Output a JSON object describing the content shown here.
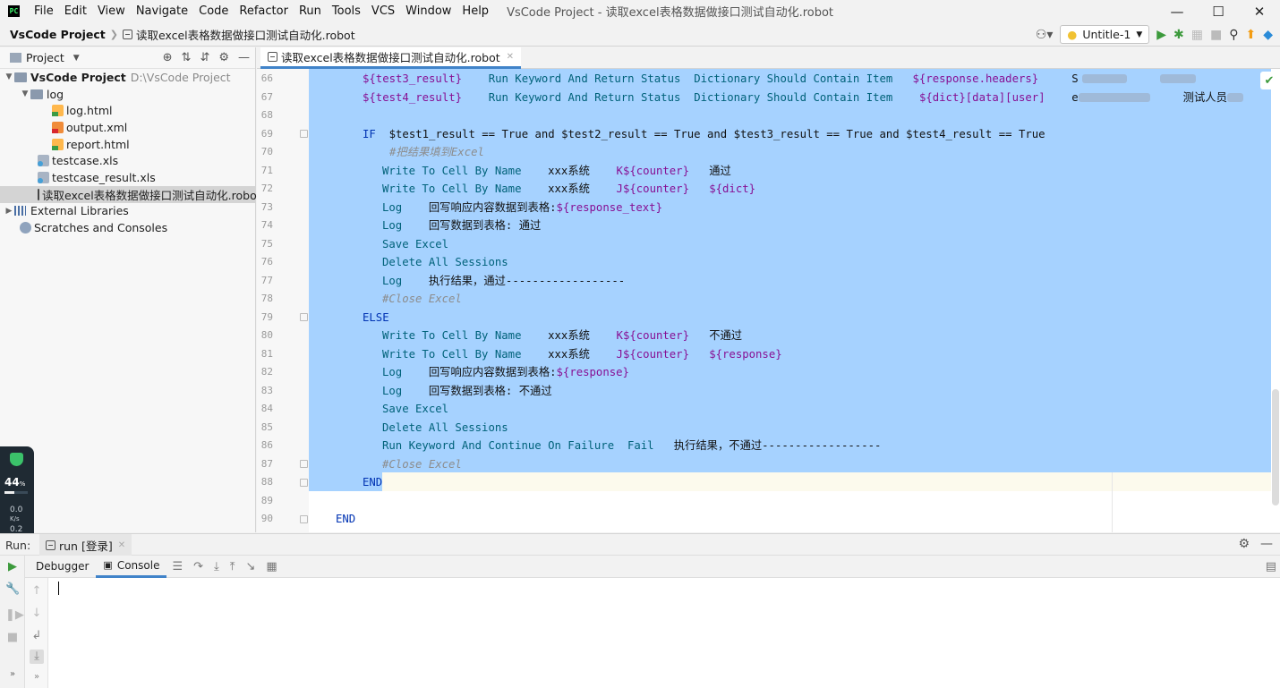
{
  "menubar": {
    "items": [
      "File",
      "Edit",
      "View",
      "Navigate",
      "Code",
      "Refactor",
      "Run",
      "Tools",
      "VCS",
      "Window",
      "Help"
    ],
    "window_title": "VsCode Project - 读取excel表格数据做接口测试自动化.robot"
  },
  "navbar": {
    "project": "VsCode Project",
    "file": "读取excel表格数据做接口测试自动化.robot",
    "run_config": "Untitle-1"
  },
  "project_panel": {
    "title": "Project",
    "root_name": "VsCode Project",
    "root_path": "D:\\VsCode Project",
    "folder_log": "log",
    "files": {
      "log_html": "log.html",
      "output_xml": "output.xml",
      "report_html": "report.html",
      "testcase": "testcase.xls",
      "testcase_result": "testcase_result.xls",
      "robot": "读取excel表格数据做接口测试自动化.robot"
    },
    "external_libraries": "External Libraries",
    "scratches": "Scratches and Consoles"
  },
  "editor": {
    "tab": "读取excel表格数据做接口测试自动化.robot",
    "line_numbers": [
      "66",
      "67",
      "68",
      "69",
      "70",
      "71",
      "72",
      "73",
      "74",
      "75",
      "76",
      "77",
      "78",
      "79",
      "80",
      "81",
      "82",
      "83",
      "84",
      "85",
      "86",
      "87",
      "88",
      "89",
      "90"
    ],
    "code": {
      "l66_var": "${test3_result}",
      "l66_kw": "Run Keyword And Return Status",
      "l66_kw2": "Dictionary Should Contain Item",
      "l66_arg": "${response.headers}",
      "l66_tail": "S",
      "l67_var": "${test4_result}",
      "l67_kw": "Run Keyword And Return Status",
      "l67_kw2": "Dictionary Should Contain Item",
      "l67_arg": "${dict}[data][user]",
      "l67_tail": "e",
      "l67_tail2": "测试人员",
      "l69_if": "IF",
      "l69_cond": "$test1_result == True and $test2_result == True and $test3_result == True and $test4_result == True",
      "l70_comment": "#把结果填到Excel",
      "write_kw": "Write To Cell By Name",
      "sys_name": "xxx系统",
      "k_counter": "K${counter}",
      "j_counter": "J${counter}",
      "pass": "通过",
      "dict_var": "${dict}",
      "log_kw": "Log",
      "l73_text": "回写响应内容数据到表格:",
      "l73_var": "${response_text}",
      "l74_text": "回写数据到表格: 通过",
      "save_kw": "Save Excel",
      "delete_kw": "Delete All Sessions",
      "l77_text": "执行结果，通过------------------",
      "close_comment": "#Close Excel",
      "else_kw": "ELSE",
      "fail_text": "不通过",
      "response_var": "${response}",
      "l82_text": "回写响应内容数据到表格:",
      "l83_text": "回写数据到表格: 不通过",
      "l86_kw": "Run Keyword And Continue On Failure",
      "l86_fail": "Fail",
      "l86_text": "执行结果，不通过------------------",
      "end_kw": "END"
    }
  },
  "net_widget": {
    "percent": "44",
    "percent_unit": "%",
    "up": "0.0",
    "unit": "K/s",
    "down": "0.2",
    "bar_fraction": 0.44
  },
  "run_panel": {
    "label": "Run:",
    "tab": "run [登录]",
    "tabs": [
      "Debugger",
      "Console"
    ]
  }
}
